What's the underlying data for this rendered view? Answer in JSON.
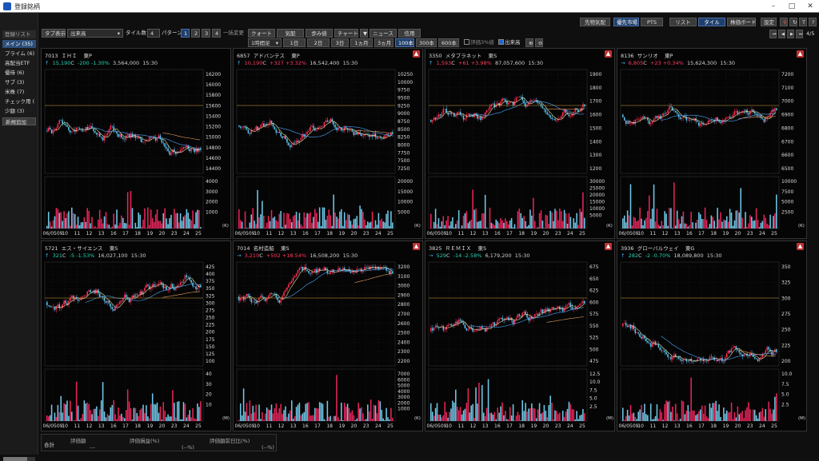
{
  "window": {
    "title": "登録銘柄"
  },
  "sidebar": {
    "header": "登録リスト",
    "items": [
      {
        "label": "メイン (35)",
        "selected": true
      },
      {
        "label": "プライム (6)"
      },
      {
        "label": "高配当ETF"
      },
      {
        "label": "優待 (6)"
      },
      {
        "label": "サブ (3)"
      },
      {
        "label": "米株 (7)"
      },
      {
        "label": "チェック用 ("
      },
      {
        "label": "少額 (3)"
      }
    ],
    "add_button": "新規追加"
  },
  "toolbar": {
    "tab_display": "タブ表示",
    "market": "出来高",
    "tile_count_label": "タイル数",
    "tile_count": "4",
    "pattern_label": "パターン",
    "patterns": [
      "1",
      "2",
      "3",
      "4"
    ],
    "batch_change": "一括変更",
    "views": [
      "クォート",
      "気配",
      "歩み値",
      "チャート",
      "ニュース",
      "信用"
    ],
    "interval": "1時間足",
    "ranges": [
      "1日",
      "2日",
      "3日",
      "1ヵ月",
      "3ヵ月",
      "100本",
      "300本",
      "600本"
    ],
    "check_ratio": "評価3%値",
    "check_volume": "出来高",
    "right_buttons": [
      "先物気配",
      "優先市場",
      "PTS",
      "リスト",
      "タイル",
      "株価ボード",
      "設定"
    ],
    "page": "4/5"
  },
  "panels": [
    {
      "code": "7013",
      "name": "ＩＨＩ",
      "market": "東P",
      "arrow": "↑",
      "price": "15,190",
      "suffix": "C",
      "change": "-200",
      "pct": "-1.30%",
      "volume": "3,564,000",
      "time": "15:30",
      "dir": "down",
      "alert": false,
      "ticks": [
        "16200",
        "16000",
        "15800",
        "15600",
        "15400",
        "15200",
        "15000",
        "14800",
        "14600",
        "14400"
      ],
      "vticks": [
        "4000",
        "3000",
        "2000",
        "1000"
      ],
      "unit": "(K)"
    },
    {
      "code": "6857",
      "name": "アドバンテス",
      "market": "東P",
      "arrow": "↑",
      "price": "10,190",
      "suffix": "C",
      "change": "+327",
      "pct": "+3.32%",
      "volume": "16,542,400",
      "time": "15:30",
      "dir": "up",
      "alert": true,
      "ticks": [
        "10250",
        "10000",
        "9750",
        "9500",
        "9250",
        "9000",
        "8750",
        "8500",
        "8250",
        "8000",
        "7750",
        "7500",
        "7250"
      ],
      "vticks": [
        "20000",
        "15000",
        "10000",
        "5000"
      ],
      "unit": "(K)"
    },
    {
      "code": "3350",
      "name": "メタプラネット",
      "market": "東S",
      "arrow": "↑",
      "price": "1,593",
      "suffix": "C",
      "change": "+61",
      "pct": "+3.98%",
      "volume": "87,057,600",
      "time": "15:30",
      "dir": "up",
      "alert": true,
      "ticks": [
        "1900",
        "1800",
        "1700",
        "1600",
        "1500",
        "1400",
        "1300",
        "1200"
      ],
      "vticks": [
        "30000",
        "25000",
        "20000",
        "15000",
        "10000",
        "5000"
      ],
      "unit": "(K)"
    },
    {
      "code": "8136",
      "name": "サンリオ",
      "market": "東P",
      "arrow": "→",
      "price": "6,805",
      "suffix": "C",
      "change": "+23",
      "pct": "+0.34%",
      "volume": "15,624,300",
      "time": "15:30",
      "dir": "up",
      "alert": true,
      "ticks": [
        "7200",
        "7100",
        "7000",
        "6900",
        "6800",
        "6700",
        "6600",
        "6500"
      ],
      "vticks": [
        "10000",
        "7500",
        "5000",
        "2500"
      ],
      "unit": "(K)"
    },
    {
      "code": "5721",
      "name": "エス・サイエンス",
      "market": "東S",
      "arrow": "↑",
      "price": "321",
      "suffix": "C",
      "change": "-5",
      "pct": "-1.53%",
      "volume": "16,027,100",
      "time": "15:30",
      "dir": "down",
      "alert": false,
      "ticks": [
        "425",
        "400",
        "375",
        "350",
        "325",
        "300",
        "275",
        "250",
        "225",
        "200",
        "175",
        "150",
        "125",
        "100"
      ],
      "vticks": [
        "40",
        "30",
        "20",
        "10"
      ],
      "unit": "(M)"
    },
    {
      "code": "7014",
      "name": "名村造船",
      "market": "東S",
      "arrow": "→",
      "price": "3,210",
      "suffix": "C",
      "change": "+502",
      "pct": "+18.54%",
      "volume": "16,508,200",
      "time": "15:30",
      "dir": "up",
      "alert": true,
      "ticks": [
        "3200",
        "3100",
        "3000",
        "2900",
        "2800",
        "2700",
        "2600",
        "2500",
        "2400",
        "2300",
        "2200"
      ],
      "vticks": [
        "7000",
        "6000",
        "5000",
        "4000",
        "3000",
        "2000",
        "1000"
      ],
      "unit": "(K)"
    },
    {
      "code": "3825",
      "name": "ＲＥＭＩＸ",
      "market": "東S",
      "arrow": "→",
      "price": "529",
      "suffix": "C",
      "change": "-14",
      "pct": "-2.58%",
      "volume": "6,179,200",
      "time": "15:30",
      "dir": "down",
      "alert": true,
      "ticks": [
        "675",
        "650",
        "625",
        "600",
        "575",
        "550",
        "525",
        "500",
        "475"
      ],
      "vticks": [
        "12.5",
        "10.0",
        "7.5",
        "5.0",
        "2.5"
      ],
      "unit": "(M)"
    },
    {
      "code": "3936",
      "name": "グローバルウェイ",
      "market": "東G",
      "arrow": "↑",
      "price": "282",
      "suffix": "C",
      "change": "-2",
      "pct": "-0.70%",
      "volume": "18,089,800",
      "time": "15:30",
      "dir": "down",
      "alert": true,
      "ticks": [
        "350",
        "325",
        "300",
        "275",
        "250",
        "225",
        "200"
      ],
      "vticks": [
        "10.0",
        "7.5",
        "5.0",
        "2.5"
      ],
      "unit": "(M)"
    }
  ],
  "xlabels": [
    "06/0509",
    "10",
    "11",
    "12",
    "13",
    "16",
    "17",
    "18",
    "19",
    "20",
    "23",
    "24",
    "25"
  ],
  "bottom": {
    "row_label": "合計",
    "headers": [
      "評価額",
      "評価損益(%)",
      "評価額前日比(%)"
    ],
    "values": [
      "---",
      "(--%)",
      "(--%)"
    ]
  }
}
